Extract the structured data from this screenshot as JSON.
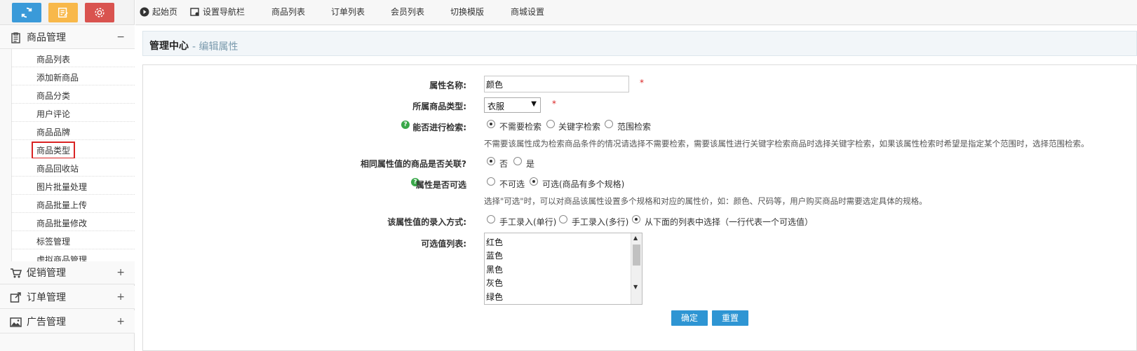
{
  "top_buttons": [
    {
      "icon": "refresh-icon",
      "color": "#3a9ad9"
    },
    {
      "icon": "edit-note-icon",
      "color": "#f8b84a"
    },
    {
      "icon": "gear-icon",
      "color": "#d9534f"
    }
  ],
  "topnav": {
    "start": "起始页",
    "set_nav": "设置导航栏",
    "product_list": "商品列表",
    "order_list": "订单列表",
    "member_list": "会员列表",
    "switch_template": "切换模版",
    "mall_settings": "商城设置"
  },
  "sidebar": {
    "product_mgmt": {
      "label": "商品管理",
      "toggle": "−"
    },
    "sub_items": [
      "商品列表",
      "添加新商品",
      "商品分类",
      "用户评论",
      "商品品牌",
      "商品类型",
      "商品回收站",
      "图片批量处理",
      "商品批量上传",
      "商品批量修改",
      "标签管理",
      "虚拟商品管理"
    ],
    "active_item": "商品类型",
    "promo": {
      "label": "促销管理",
      "toggle": "+"
    },
    "orders": {
      "label": "订单管理",
      "toggle": "+"
    },
    "ads": {
      "label": "广告管理",
      "toggle": "+"
    }
  },
  "breadcrumb": {
    "home": "管理中心",
    "current": "- 编辑属性"
  },
  "form": {
    "attr_name_label": "属性名称:",
    "attr_name_value": "颜色",
    "required_mark": "*",
    "goods_type_label": "所属商品类型:",
    "goods_type_value": "衣服",
    "searchable_label": "能否进行检索:",
    "search_options": [
      "不需要检索",
      "关键字检索",
      "范围检索"
    ],
    "search_selected": "不需要检索",
    "search_hint": "不需要该属性成为检索商品条件的情况请选择不需要检索，需要该属性进行关键字检索商品时选择关键字检索，如果该属性检索时希望是指定某个范围时，选择范围检索。",
    "linked_label": "相同属性值的商品是否关联?",
    "linked_options": [
      "否",
      "是"
    ],
    "linked_selected": "否",
    "selectable_label": "属性是否可选",
    "selectable_options": [
      "不可选",
      "可选(商品有多个规格)"
    ],
    "selectable_selected": "可选(商品有多个规格)",
    "selectable_hint": "选择\"可选\"时，可以对商品该属性设置多个规格和对应的属性价，如：颜色、尺码等，用户购买商品时需要选定具体的规格。",
    "input_mode_label": "该属性值的录入方式:",
    "input_mode_options": [
      "手工录入(单行)",
      "手工录入(多行)",
      "从下面的列表中选择（一行代表一个可选值）"
    ],
    "input_mode_selected": "从下面的列表中选择（一行代表一个可选值）",
    "values_label": "可选值列表:",
    "values": [
      "红色",
      "蓝色",
      "黑色",
      "灰色",
      "绿色"
    ],
    "confirm_button": "确定",
    "reset_button": "重置"
  }
}
